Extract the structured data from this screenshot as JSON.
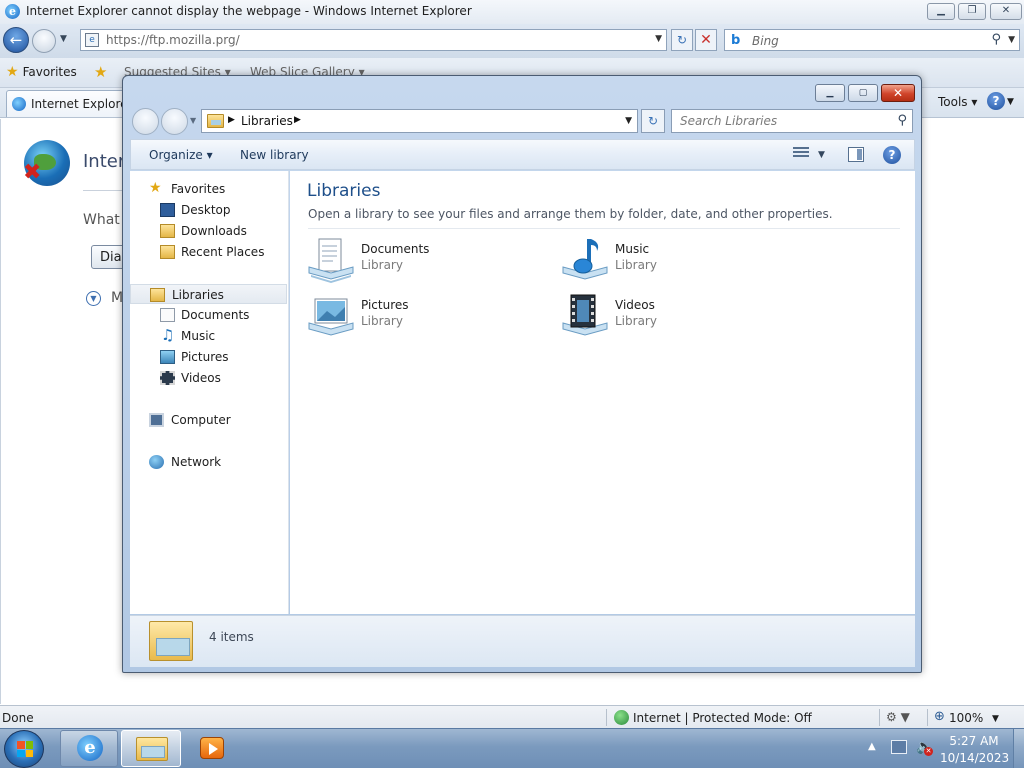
{
  "ie": {
    "title": "Internet Explorer cannot display the webpage - Windows Internet Explorer",
    "caption": {
      "minimize": "▁",
      "maximize": "❐",
      "close": "✕"
    },
    "address": "https://ftp.mozilla.prg/",
    "search_placeholder": "Bing",
    "favorites_label": "Favorites",
    "fav_links": [
      "Suggested Sites ▾",
      "Web Slice Gallery ▾"
    ],
    "tab_title": "Internet Explorer c",
    "tools_label": "Tools ▾",
    "page": {
      "title": "Intern",
      "prompt": "What y",
      "button": "Diag",
      "more": "M"
    },
    "status": {
      "done": "Done",
      "zone": "Internet | Protected Mode: Off",
      "zoom": "100%"
    },
    "icons": [
      "ie-logo-icon",
      "back-icon",
      "forward-icon",
      "refresh-icon",
      "stop-icon",
      "bing-icon",
      "search-icon",
      "star-icon",
      "help-icon",
      "globe-icon",
      "zoom-icon"
    ]
  },
  "explorer": {
    "breadcrumb": "Libraries",
    "search_placeholder": "Search Libraries",
    "toolbar": {
      "organize": "Organize ▾",
      "new_library": "New library"
    },
    "nav": {
      "favorites": [
        "Favorites",
        "Desktop",
        "Downloads",
        "Recent Places"
      ],
      "libraries": [
        "Libraries",
        "Documents",
        "Music",
        "Pictures",
        "Videos"
      ],
      "computer": "Computer",
      "network": "Network"
    },
    "heading": "Libraries",
    "subheading": "Open a library to see your files and arrange them by folder, date, and other properties.",
    "libraries": [
      {
        "name": "Documents",
        "type": "Library"
      },
      {
        "name": "Music",
        "type": "Library"
      },
      {
        "name": "Pictures",
        "type": "Library"
      },
      {
        "name": "Videos",
        "type": "Library"
      }
    ],
    "status": "4 items"
  },
  "taskbar": {
    "time": "5:27 AM",
    "date": "10/14/2023",
    "pinned": [
      "Internet Explorer",
      "Windows Explorer",
      "Windows Media Player"
    ]
  },
  "colors": {
    "accent": "#1e4f8a",
    "taskbar": "#7b9abe",
    "close": "#d0442a"
  }
}
